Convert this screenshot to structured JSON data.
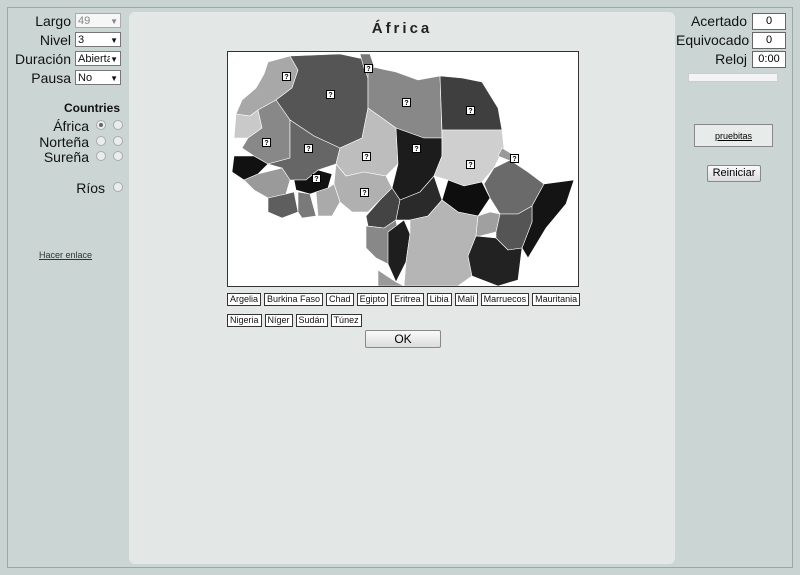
{
  "controls": {
    "largo": {
      "label": "Largo",
      "value": "49"
    },
    "nivel": {
      "label": "Nivel",
      "value": "3"
    },
    "duracion": {
      "label": "Duración",
      "value": "Abierta"
    },
    "pausa": {
      "label": "Pausa",
      "value": "No"
    }
  },
  "countries": {
    "heading": "Countries",
    "options": [
      {
        "label": "África",
        "selected": true
      },
      {
        "label": "Norteña",
        "selected": false
      },
      {
        "label": "Sureña",
        "selected": false
      }
    ],
    "rios": {
      "label": "Ríos"
    }
  },
  "link": "Hacer enlace",
  "main": {
    "title": "África",
    "chips": [
      "Argelia",
      "Burkina Faso",
      "Chad",
      "Egipto",
      "Eritrea",
      "Libia",
      "Malí",
      "Marruecos",
      "Mauritania",
      "Nigeria",
      "Níger",
      "Sudán",
      "Túnez"
    ],
    "ok_label": "OK",
    "marker": "?"
  },
  "stats": {
    "acertado": {
      "label": "Acertado",
      "value": "0"
    },
    "equivocado": {
      "label": "Equivocado",
      "value": "0"
    },
    "reloj": {
      "label": "Reloj",
      "value": "0:00"
    }
  },
  "pruebitas": "pruebitas",
  "reiniciar": "Reiniciar"
}
